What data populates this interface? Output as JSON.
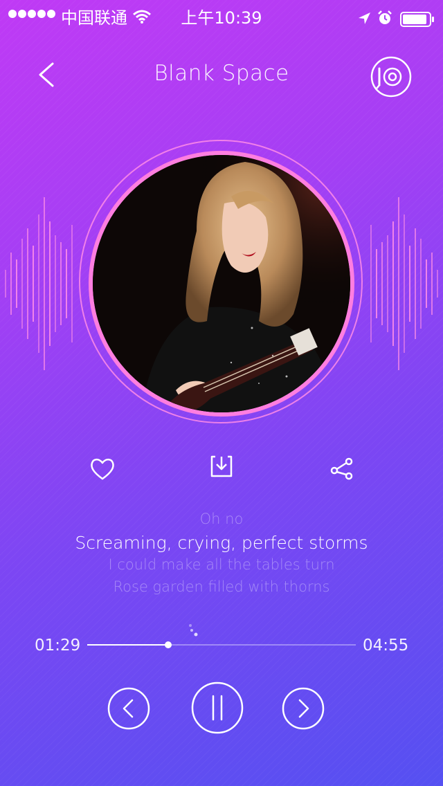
{
  "status_bar": {
    "carrier": "中国联通",
    "time": "上午10:39"
  },
  "header": {
    "title": "Blank Space"
  },
  "lyrics": {
    "previous": "Oh no",
    "current": "Screaming, crying, perfect storms",
    "next": [
      "I could make all the tables turn",
      "Rose garden filled with thorns"
    ]
  },
  "player": {
    "elapsed": "01:29",
    "total": "04:55",
    "progress_fraction": 0.301,
    "state": "playing"
  },
  "icons": {
    "back": "chevron-left-icon",
    "vinyl": "vinyl-record-icon",
    "like": "heart-icon",
    "download": "download-icon",
    "share": "share-icon",
    "prev": "previous-track-icon",
    "pause": "pause-icon",
    "next": "next-track-icon"
  },
  "colors": {
    "accent_ring": "#ff7ee0",
    "gradient_top": "#c03af5",
    "gradient_bottom": "#5550f2"
  }
}
